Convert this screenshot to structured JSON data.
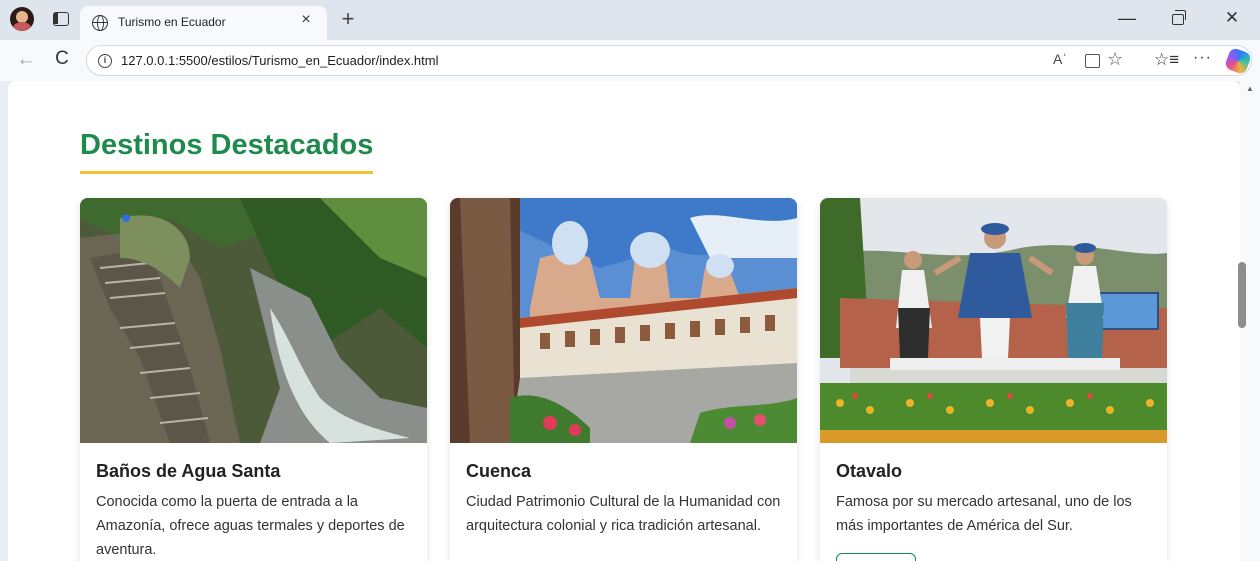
{
  "browser": {
    "tab_title": "Turismo en Ecuador",
    "tab_close": "×",
    "new_tab": "+",
    "url": "127.0.0.1:5500/estilos/Turismo_en_Ecuador/index.html",
    "read_aloud": "Aʾ",
    "window_min": "—",
    "window_close": "✕",
    "back": "←",
    "reload": "C",
    "favorites_star": "☆",
    "favorites_bar": "☆≡",
    "more": "···"
  },
  "page": {
    "section_title": "Destinos Destacados",
    "accent_color": "#1e8a4c",
    "underline_color": "#f1c232"
  },
  "cards": [
    {
      "title": "Baños de Agua Santa",
      "description": "Conocida como la puerta de entrada a la Amazonía, ofrece aguas termales y deportes de aventura.",
      "image": "waterfall-canyon-photo"
    },
    {
      "title": "Cuenca",
      "description": "Ciudad Patrimonio Cultural de la Humanidad con arquitectura colonial y rica tradición artesanal.",
      "image": "cathedral-courtyard-photo"
    },
    {
      "title": "Otavalo",
      "description": "Famosa por su mercado artesanal, uno de los más importantes de América del Sur.",
      "image": "statues-monument-photo"
    }
  ]
}
